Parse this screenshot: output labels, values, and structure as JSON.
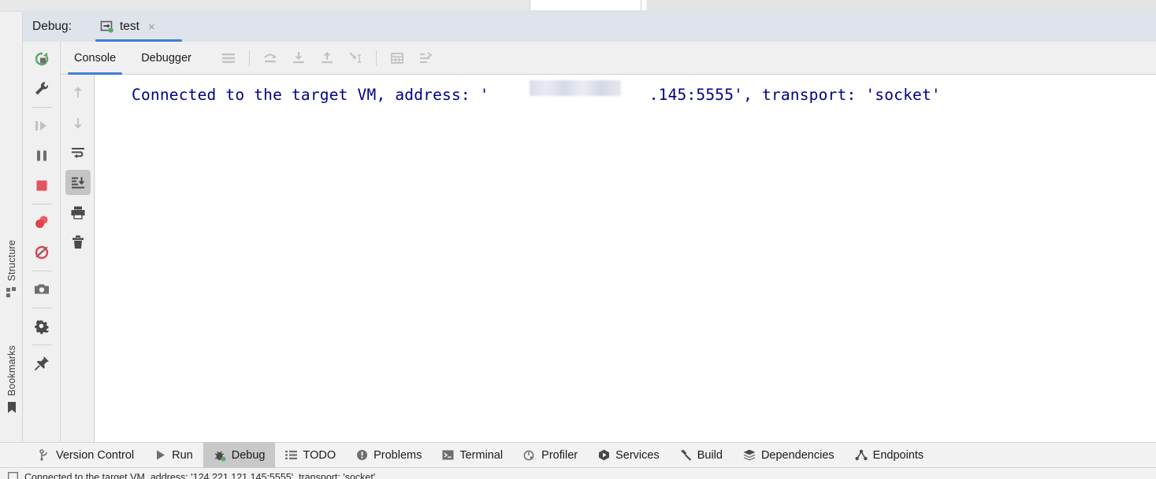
{
  "header": {
    "title": "Debug:",
    "tab": {
      "label": "test",
      "icon": "remote-debug-icon",
      "close": "×",
      "running": true
    }
  },
  "console_tabs": [
    {
      "label": "Console",
      "active": true
    },
    {
      "label": "Debugger",
      "active": false
    }
  ],
  "console_toolbar": [
    {
      "name": "frames-menu-icon",
      "enabled": true
    },
    {
      "name": "step-over-icon",
      "enabled": false
    },
    {
      "name": "step-into-icon",
      "enabled": false
    },
    {
      "name": "step-out-icon",
      "enabled": false
    },
    {
      "name": "run-to-cursor-icon",
      "enabled": false
    },
    {
      "name": "evaluate-expression-icon",
      "enabled": false
    },
    {
      "name": "settings-layout-icon",
      "enabled": false
    }
  ],
  "left_toolbar": [
    {
      "name": "rerun-icon",
      "enabled": true
    },
    {
      "name": "edit-configuration-icon",
      "enabled": true
    },
    {
      "name": "resume-program-icon",
      "enabled": false
    },
    {
      "name": "pause-program-icon",
      "enabled": true
    },
    {
      "name": "stop-icon",
      "enabled": true
    },
    {
      "name": "view-breakpoints-icon",
      "enabled": true
    },
    {
      "name": "mute-breakpoints-icon",
      "enabled": true
    },
    {
      "name": "screenshot-icon",
      "enabled": true
    },
    {
      "name": "settings-gear-icon",
      "enabled": true
    },
    {
      "name": "pin-tab-icon",
      "enabled": true
    }
  ],
  "console_toolbar_left": [
    {
      "name": "previous-occurrence-icon",
      "enabled": false
    },
    {
      "name": "next-occurrence-icon",
      "enabled": false
    },
    {
      "name": "soft-wrap-icon",
      "enabled": true
    },
    {
      "name": "scroll-to-end-icon",
      "enabled": true,
      "active": true
    },
    {
      "name": "print-icon",
      "enabled": true
    },
    {
      "name": "clear-all-icon",
      "enabled": true
    }
  ],
  "console": {
    "line": "Connected to the target VM, address: '                 .145:5555', transport: 'socket'",
    "redacted_address": "124.221.121",
    "text_color": "#000088"
  },
  "rail": [
    {
      "label": "Structure",
      "icon": "structure-icon"
    },
    {
      "label": "Bookmarks",
      "icon": "bookmark-icon"
    }
  ],
  "bottom_bar": [
    {
      "label": "Version Control",
      "icon": "branch-icon",
      "active": false
    },
    {
      "label": "Run",
      "icon": "run-icon",
      "active": false
    },
    {
      "label": "Debug",
      "icon": "debug-bug-icon",
      "active": true
    },
    {
      "label": "TODO",
      "icon": "todo-list-icon",
      "active": false
    },
    {
      "label": "Problems",
      "icon": "problems-icon",
      "active": false
    },
    {
      "label": "Terminal",
      "icon": "terminal-icon",
      "active": false
    },
    {
      "label": "Profiler",
      "icon": "profiler-icon",
      "active": false
    },
    {
      "label": "Services",
      "icon": "services-icon",
      "active": false
    },
    {
      "label": "Build",
      "icon": "build-hammer-icon",
      "active": false
    },
    {
      "label": "Dependencies",
      "icon": "dependencies-icon",
      "active": false
    },
    {
      "label": "Endpoints",
      "icon": "endpoints-icon",
      "active": false
    }
  ],
  "status": {
    "icon": "console-icon",
    "text": "Connected to the target VM, address: '124.221.121.145:5555', transport: 'socket'"
  },
  "colors": {
    "accent_blue": "#3e7fd5",
    "header_bg": "#dfe3eb",
    "panel_bg": "#f0f0f0",
    "console_text": "#000088",
    "stop_red": "#e05561",
    "run_green": "#59a869"
  }
}
